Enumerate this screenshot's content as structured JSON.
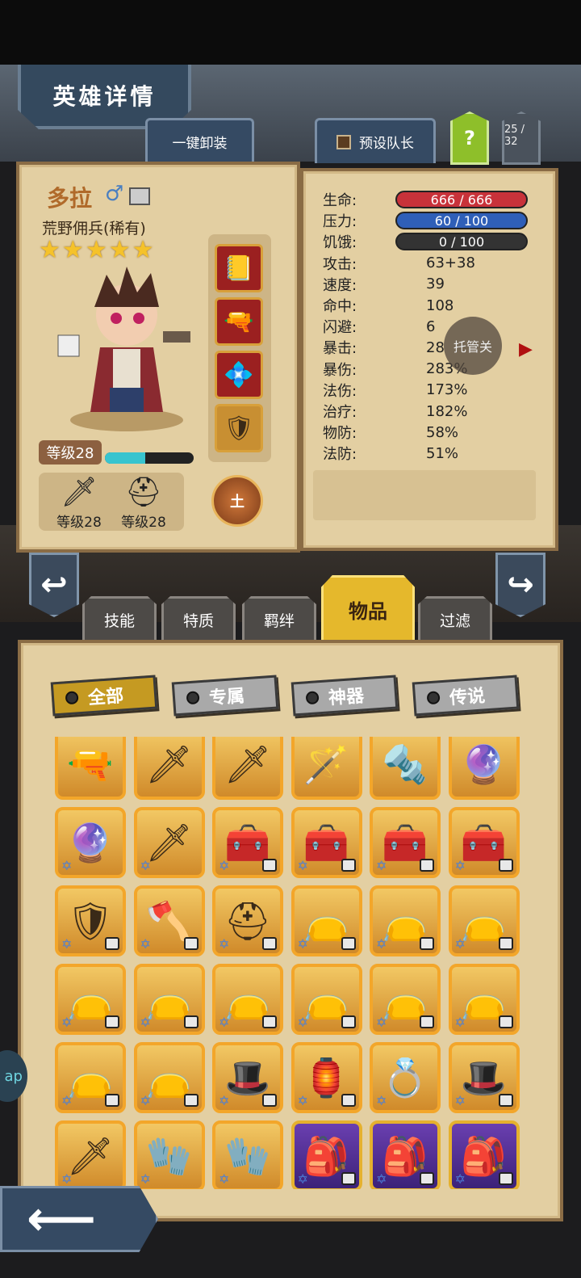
{
  "header": {
    "title": "英雄详情",
    "unequip_label": "一键卸装",
    "preset_label": "预设队长",
    "help_label": "?",
    "count": "25 / 32"
  },
  "hero": {
    "name": "多拉",
    "gender_icon": "male-icon",
    "class": "荒野佣兵(稀有)",
    "stars": 5,
    "level": "等级28",
    "xp_fraction": 0.45,
    "weapon_level": "等级28",
    "armor_level": "等级28",
    "element": "土",
    "equip_slots": [
      "spellbook-icon",
      "revolver-icon",
      "crest-icon",
      "shield-icon"
    ]
  },
  "stats": [
    {
      "label": "生命:",
      "value": "666 / 666",
      "bar": "#c8323a"
    },
    {
      "label": "压力:",
      "value": "60 / 100",
      "bar": "#2f5fb8"
    },
    {
      "label": "饥饿:",
      "value": "0 / 100",
      "bar": "#333333"
    },
    {
      "label": "攻击:",
      "value": "63+38"
    },
    {
      "label": "速度:",
      "value": "39"
    },
    {
      "label": "命中:",
      "value": "108"
    },
    {
      "label": "闪避:",
      "value": "6"
    },
    {
      "label": "暴击:",
      "value": "28"
    },
    {
      "label": "暴伤:",
      "value": "283%"
    },
    {
      "label": "法伤:",
      "value": "173%"
    },
    {
      "label": "治疗:",
      "value": "182%"
    },
    {
      "label": "物防:",
      "value": "58%"
    },
    {
      "label": "法防:",
      "value": "51%"
    }
  ],
  "auto_label": "托管关",
  "category_tabs": [
    "技能",
    "特质",
    "羁绊",
    "物品",
    "过滤"
  ],
  "active_tab": "物品",
  "filters": [
    "全部",
    "专属",
    "神器",
    "传说"
  ],
  "active_filter": "全部",
  "items": [
    {
      "icon": "🔫",
      "name": "revolver-icon",
      "locked": false,
      "purple": false
    },
    {
      "icon": "🗡",
      "name": "rapier-icon",
      "locked": false,
      "purple": false
    },
    {
      "icon": "🗡",
      "name": "rapier-icon",
      "locked": false,
      "purple": false
    },
    {
      "icon": "🪄",
      "name": "staff-icon",
      "locked": false,
      "purple": false
    },
    {
      "icon": "🔩",
      "name": "drill-icon",
      "locked": false,
      "purple": false
    },
    {
      "icon": "🔮",
      "name": "orb-staff-icon",
      "locked": false,
      "purple": false
    },
    {
      "icon": "🔮",
      "name": "orb-staff-icon",
      "locked": false,
      "purple": false
    },
    {
      "icon": "🗡",
      "name": "sword-icon",
      "locked": false,
      "purple": false
    },
    {
      "icon": "🧰",
      "name": "chest-icon",
      "locked": true,
      "purple": false
    },
    {
      "icon": "🧰",
      "name": "chest-icon",
      "locked": true,
      "purple": false
    },
    {
      "icon": "🧰",
      "name": "chest-icon",
      "locked": true,
      "purple": false
    },
    {
      "icon": "🧰",
      "name": "chest-icon",
      "locked": true,
      "purple": false
    },
    {
      "icon": "🛡",
      "name": "shield-icon",
      "locked": true,
      "purple": false
    },
    {
      "icon": "🪓",
      "name": "axe-icon",
      "locked": true,
      "purple": false
    },
    {
      "icon": "⛑",
      "name": "helmet-icon",
      "locked": true,
      "purple": false
    },
    {
      "icon": "👝",
      "name": "pouch-icon",
      "locked": true,
      "purple": false
    },
    {
      "icon": "👝",
      "name": "pouch-icon",
      "locked": true,
      "purple": false
    },
    {
      "icon": "👝",
      "name": "pouch-icon",
      "locked": true,
      "purple": false
    },
    {
      "icon": "👝",
      "name": "pouch-icon",
      "locked": true,
      "purple": false
    },
    {
      "icon": "👝",
      "name": "pouch-icon",
      "locked": true,
      "purple": false
    },
    {
      "icon": "👝",
      "name": "pouch-icon",
      "locked": true,
      "purple": false
    },
    {
      "icon": "👝",
      "name": "pouch-icon",
      "locked": true,
      "purple": false
    },
    {
      "icon": "👝",
      "name": "pouch-icon",
      "locked": true,
      "purple": false
    },
    {
      "icon": "👝",
      "name": "pouch-icon",
      "locked": true,
      "purple": false
    },
    {
      "icon": "👝",
      "name": "pouch-icon",
      "locked": true,
      "purple": false
    },
    {
      "icon": "👝",
      "name": "pouch-icon",
      "locked": true,
      "purple": false
    },
    {
      "icon": "🎩",
      "name": "wizard-hat-icon",
      "locked": true,
      "purple": false
    },
    {
      "icon": "🏮",
      "name": "lantern-icon",
      "locked": true,
      "purple": false
    },
    {
      "icon": "💍",
      "name": "ring-icon",
      "locked": false,
      "purple": false
    },
    {
      "icon": "🎩",
      "name": "wizard-hat-icon",
      "locked": true,
      "purple": false
    },
    {
      "icon": "🗡",
      "name": "crystal-sword-icon",
      "locked": false,
      "purple": false
    },
    {
      "icon": "🧤",
      "name": "gauntlet-icon",
      "locked": false,
      "purple": false
    },
    {
      "icon": "🧤",
      "name": "glove-icon",
      "locked": false,
      "purple": false
    },
    {
      "icon": "🎒",
      "name": "backpack-icon",
      "locked": true,
      "purple": true
    },
    {
      "icon": "🎒",
      "name": "backpack-icon",
      "locked": true,
      "purple": true
    },
    {
      "icon": "🎒",
      "name": "backpack-icon",
      "locked": true,
      "purple": true
    }
  ],
  "side_float_label": "ap"
}
